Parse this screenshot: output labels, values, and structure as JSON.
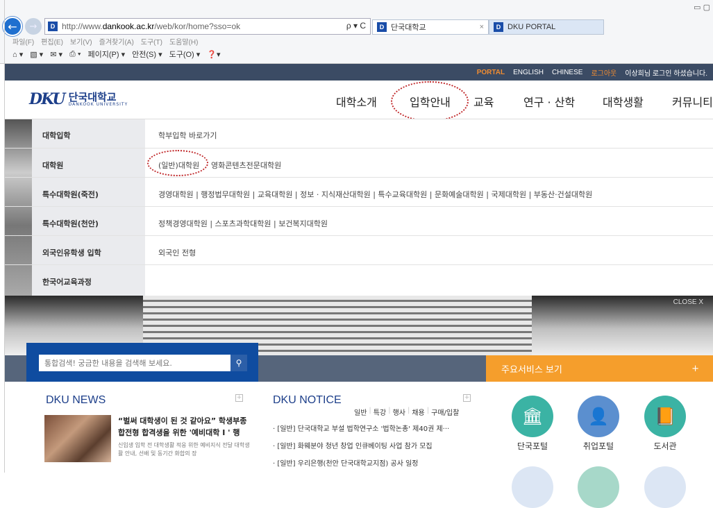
{
  "browser": {
    "url_prefix": "http://www.",
    "url_domain": "dankook.ac.kr",
    "url_rest": "/web/kor/home?sso=ok",
    "addr_controls": "ρ ▾ C",
    "tabs": [
      {
        "label": "단국대학교",
        "favicon": "D"
      },
      {
        "label": "DKU PORTAL",
        "favicon": "D"
      }
    ],
    "menu": [
      "파일(F)",
      "편집(E)",
      "보기(V)",
      "즐겨찾기(A)",
      "도구(T)",
      "도움말(H)"
    ],
    "commands": [
      "페이지(P) ▾",
      "안전(S) ▾",
      "도구(O) ▾"
    ]
  },
  "util": {
    "portal": "PORTAL",
    "english": "ENGLISH",
    "chinese": "CHINESE",
    "logout": "로그아웃",
    "greeting": "이상희님 로그인 하셨습니다."
  },
  "logo": {
    "mark": "DKU",
    "ko": "단국대학교",
    "en": "DANKOOK UNIVERSITY"
  },
  "gnb": [
    "대학소개",
    "입학안내",
    "교육",
    "연구 · 산학",
    "대학생활",
    "커뮤니티"
  ],
  "mega": [
    {
      "cat": "대학입학",
      "links": "학부입학 바로가기"
    },
    {
      "cat": "대학원",
      "links_a": "(일반)대학원",
      "links_b": "영화콘텐츠전문대학원"
    },
    {
      "cat": "특수대학원(죽전)",
      "links": "경영대학원 | 행정법무대학원 | 교육대학원 | 정보 · 지식재산대학원 | 특수교육대학원 | 문화예술대학원 | 국제대학원 | 부동산·건설대학원"
    },
    {
      "cat": "특수대학원(천안)",
      "links": "정책경영대학원 | 스포츠과학대학원 | 보건복지대학원"
    },
    {
      "cat": "외국인유학생 입학",
      "links": "외국인 전형"
    },
    {
      "cat": "한국어교육과정",
      "links": ""
    }
  ],
  "hero": {
    "close": "CLOSE X"
  },
  "search": {
    "placeholder": "통합검색! 궁금한 내용을 검색해 보세요."
  },
  "services_bar": {
    "label": "주요서비스 보기",
    "plus": "+"
  },
  "news": {
    "title_a": "DKU ",
    "title_b": "NEWS",
    "headline": "“벌써 대학생이 된 것 같아요” 학생부종합전형 합격생을 위한 '예비대학 I ' 행",
    "desc": "신입생 입학 전 대학생활 적응 위한 예비지식 전달 대학생활 안내, 선배 및 동기간 화합의 장"
  },
  "notice": {
    "title_a": "DKU ",
    "title_b": "NOTICE",
    "tabs": [
      "일반",
      "특강",
      "행사",
      "채용",
      "구매/입찰"
    ],
    "items": [
      "· [일반] 단국대학교 부설 법학연구소 '법학논총' 제40권 제···",
      "· [일반] 화웨분야 청년 창업 인큐베이팅 사업 참가 모집",
      "· [일반] 우리은행(천안 단국대학교지점) 공사 일정"
    ]
  },
  "services": [
    {
      "label": "단국포털",
      "icon": "building-icon",
      "color": "#3bb3a4"
    },
    {
      "label": "취업포털",
      "icon": "person-icon",
      "color": "#5b8fcf"
    },
    {
      "label": "도서관",
      "icon": "book-icon",
      "color": "#3bb3a4"
    }
  ]
}
